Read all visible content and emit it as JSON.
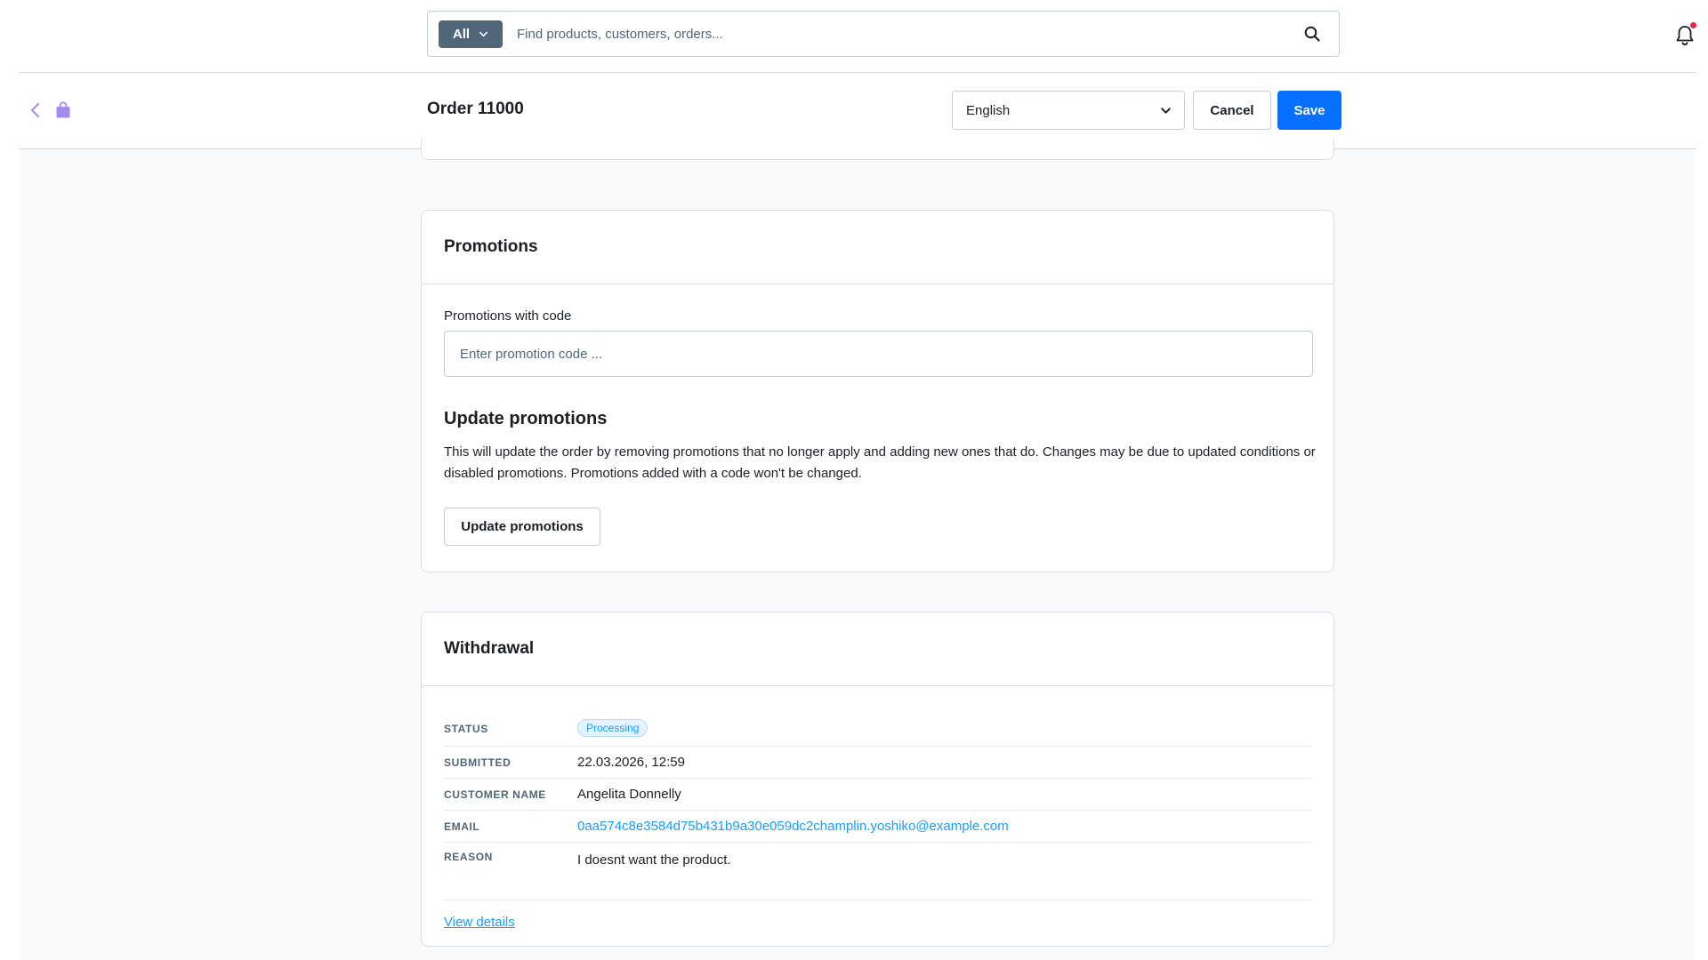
{
  "search": {
    "type_label": "All",
    "placeholder": "Find products, customers, orders..."
  },
  "header": {
    "title": "Order 11000",
    "language": "English",
    "cancel_label": "Cancel",
    "save_label": "Save"
  },
  "promotions": {
    "title": "Promotions",
    "code_label": "Promotions with code",
    "code_placeholder": "Enter promotion code ...",
    "update_title": "Update promotions",
    "update_description": "This will update the order by removing promotions that no longer apply and adding new ones that do. Changes may be due to updated conditions or disabled promotions. Promotions added with a code won't be changed.",
    "update_button": "Update promotions"
  },
  "withdrawal": {
    "title": "Withdrawal",
    "rows": [
      {
        "key": "STATUS",
        "value": "Processing"
      },
      {
        "key": "SUBMITTED",
        "value": "22.03.2026, 12:59"
      },
      {
        "key": "CUSTOMER NAME",
        "value": "Angelita Donnelly"
      },
      {
        "key": "EMAIL",
        "value": "0aa574c8e3584d75b431b9a30e059dc2champlin.yoshiko@example.com"
      },
      {
        "key": "REASON",
        "value": "I doesnt want the product."
      }
    ],
    "view_details": "View details"
  },
  "colors": {
    "primary": "#0870ff",
    "link": "#189eff",
    "module_icon": "#a38cf0",
    "notification_dot": "#de294c"
  },
  "icons": {
    "search": "search-icon",
    "bell": "bell-icon",
    "back": "chevron-left-icon",
    "module": "shopping-bag-icon",
    "dropdown": "chevron-down-icon"
  }
}
